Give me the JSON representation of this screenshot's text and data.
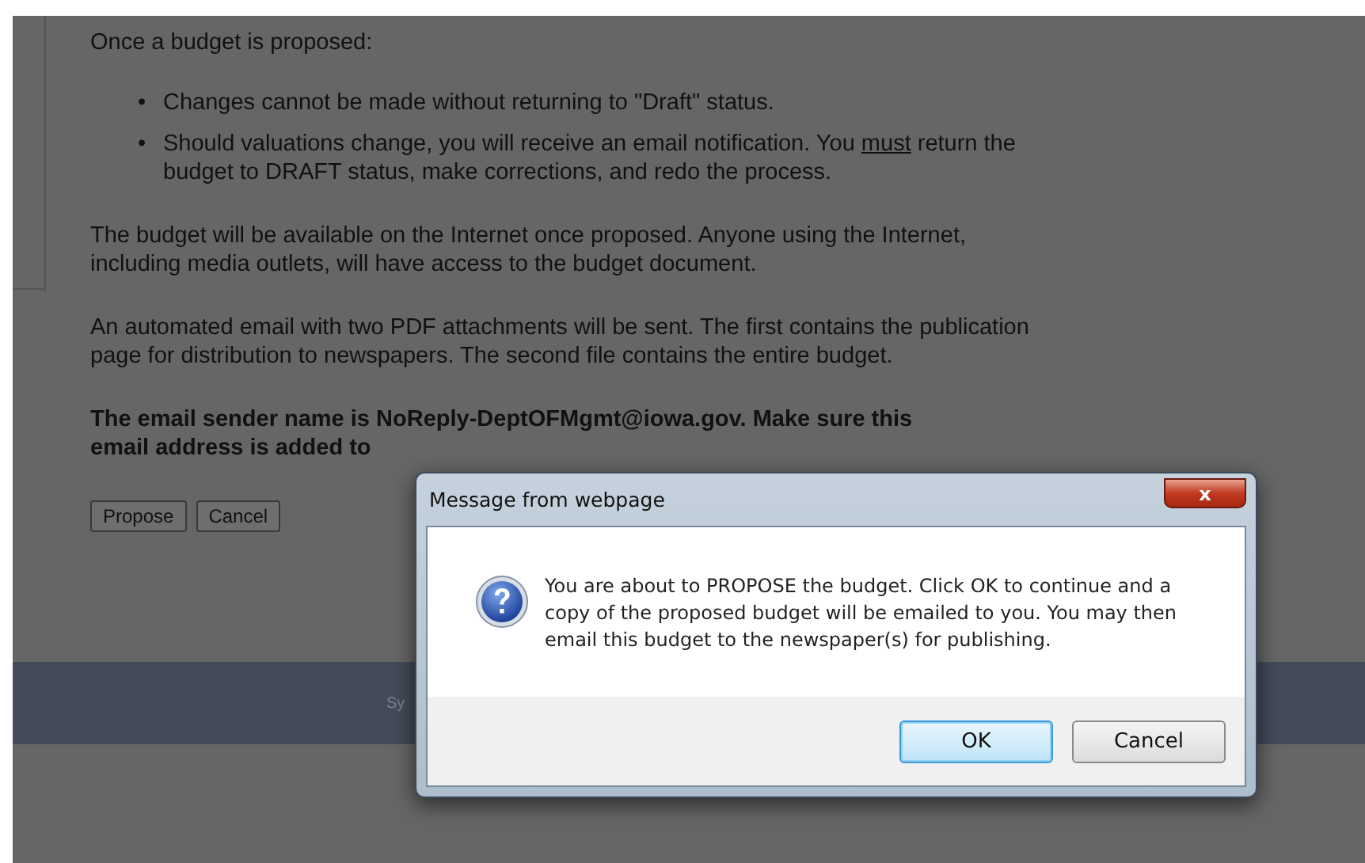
{
  "page": {
    "intro": "Once a budget is proposed:",
    "bullets": [
      {
        "marker": "•",
        "parts": [
          {
            "text": "Changes cannot be made without returning to \"Draft\" status.",
            "underline": false
          }
        ]
      },
      {
        "marker": "•",
        "parts": [
          {
            "text": "Should valuations change, you will receive an email notification. You ",
            "underline": false
          },
          {
            "text": "must",
            "underline": true
          },
          {
            "text": " return the budget to DRAFT status, make corrections, and redo the process.",
            "underline": false
          }
        ]
      }
    ],
    "paragraphs": [
      "The budget will be available on the Internet once proposed. Anyone using the Internet, including media outlets, will have access to the budget document.",
      "An automated email with two PDF attachments will be sent. The first contains the publication page for distribution to newspapers. The second file contains the entire budget."
    ],
    "notice_lines": [
      "The email sender name is NoReply-DeptOFMgmt@iowa.gov. Make sure this",
      "email address is added to"
    ],
    "buttons": [
      "Propose",
      "Cancel"
    ],
    "footer": "Sy"
  },
  "dialog": {
    "title": "Message from webpage",
    "close": "x",
    "message": "You are about to PROPOSE the budget. Click OK to continue and a copy of the proposed budget will be emailed to you. You may then email this budget to the newspaper(s) for publishing.",
    "buttons": [
      {
        "label": "OK",
        "default": true
      },
      {
        "label": "Cancel",
        "default": false
      }
    ]
  }
}
